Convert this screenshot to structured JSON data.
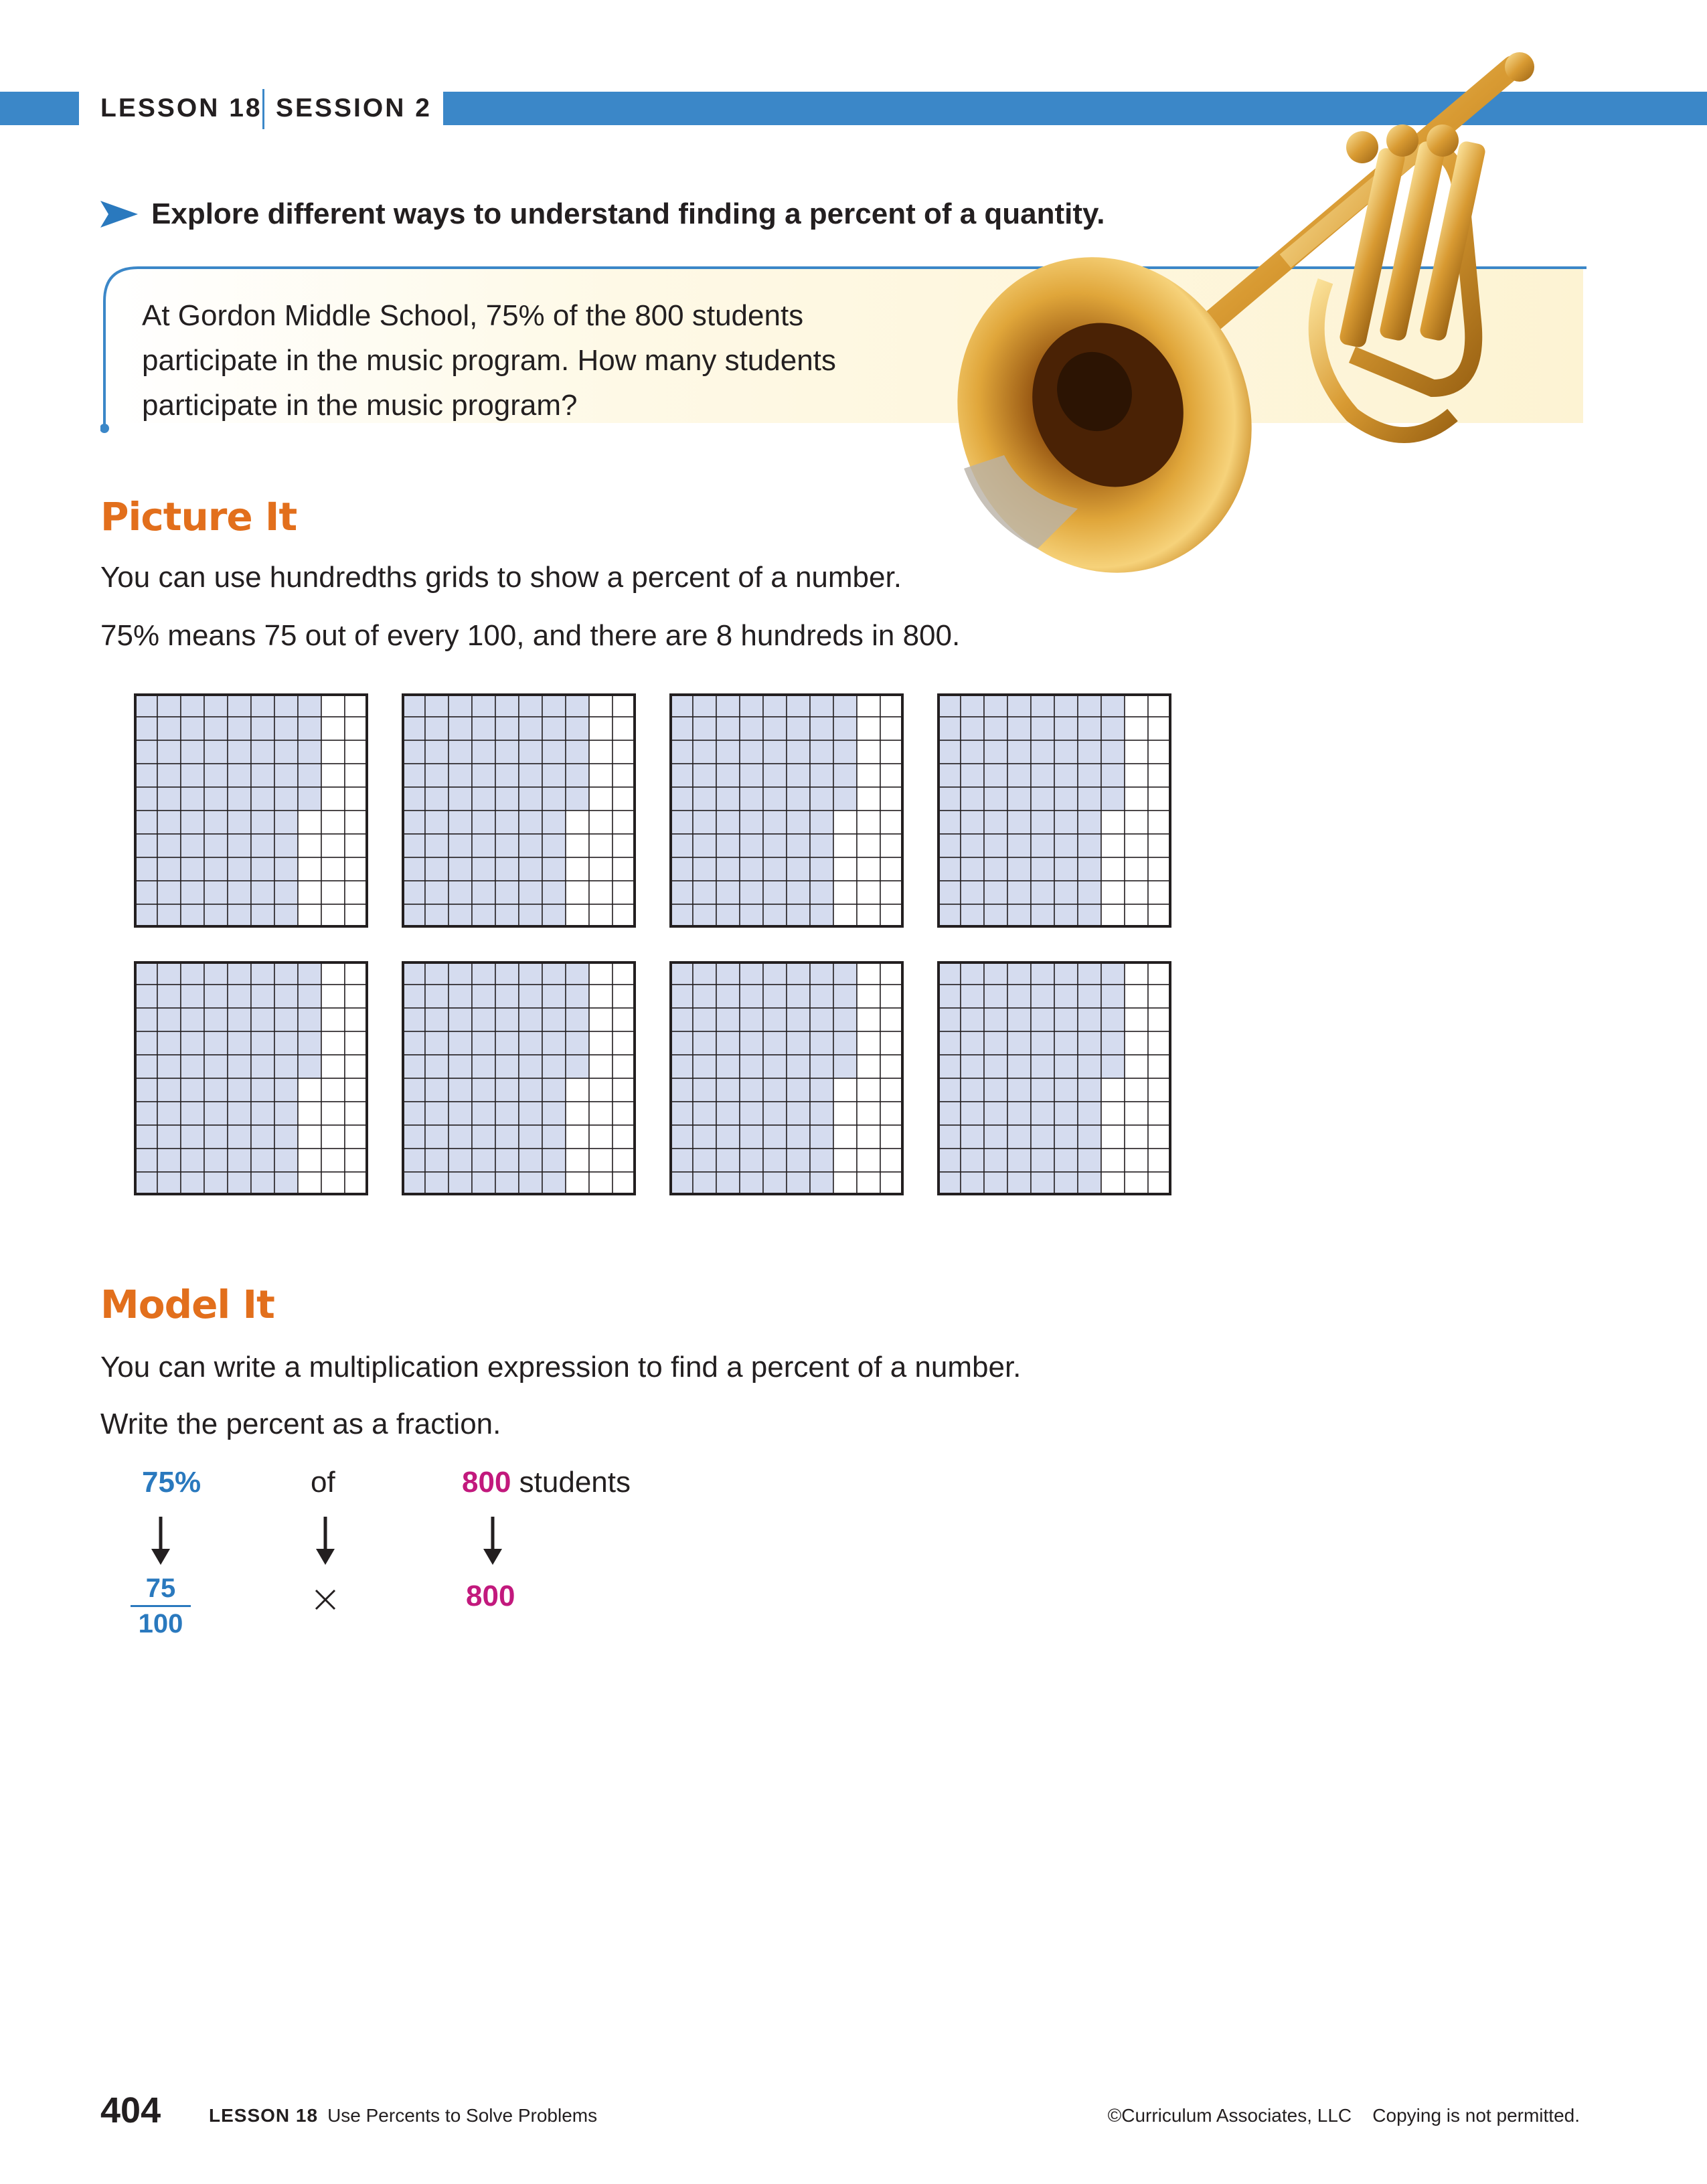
{
  "header": {
    "lesson_label": "LESSON 18",
    "session_label": "SESSION 2",
    "accent_color": "#3b87c8"
  },
  "goal": {
    "text": "Explore different ways to understand finding a percent of a quantity.",
    "icon": "arrow-bullet-icon"
  },
  "problem": {
    "lines": [
      "At Gordon Middle School, 75% of the 800 students",
      "participate in the music program. How many students",
      "participate in the music program?"
    ]
  },
  "illustration": {
    "icon": "trumpet-icon"
  },
  "picture_it": {
    "title": "Picture It",
    "lines": [
      "You can use hundredths grids to show a percent of a number.",
      "75% means 75 out of every 100, and there are 8 hundreds in 800."
    ],
    "grids": [
      {
        "shaded": 75,
        "total": 100
      },
      {
        "shaded": 75,
        "total": 100
      },
      {
        "shaded": 75,
        "total": 100
      },
      {
        "shaded": 75,
        "total": 100
      },
      {
        "shaded": 75,
        "total": 100
      },
      {
        "shaded": 75,
        "total": 100
      },
      {
        "shaded": 75,
        "total": 100
      },
      {
        "shaded": 75,
        "total": 100
      }
    ],
    "shade_color": "#d5dcef"
  },
  "model_it": {
    "title": "Model It",
    "lines": [
      "You can write a multiplication expression to find a percent of a number.",
      "Write the percent as a fraction."
    ],
    "expression_top": {
      "percent": "75%",
      "of": "of",
      "quantity": "800",
      "unit": "students"
    },
    "expression_bottom": {
      "numerator": "75",
      "denominator": "100",
      "operator": "×",
      "quantity": "800"
    },
    "colors": {
      "percent": "#2a79be",
      "quantity": "#c2197d"
    }
  },
  "footer": {
    "page_number": "404",
    "lesson_label": "LESSON 18",
    "lesson_title": "Use Percents to Solve Problems",
    "copyright": "©Curriculum Associates, LLC",
    "notice": "Copying is not permitted."
  },
  "section_color": "#e26f1c"
}
